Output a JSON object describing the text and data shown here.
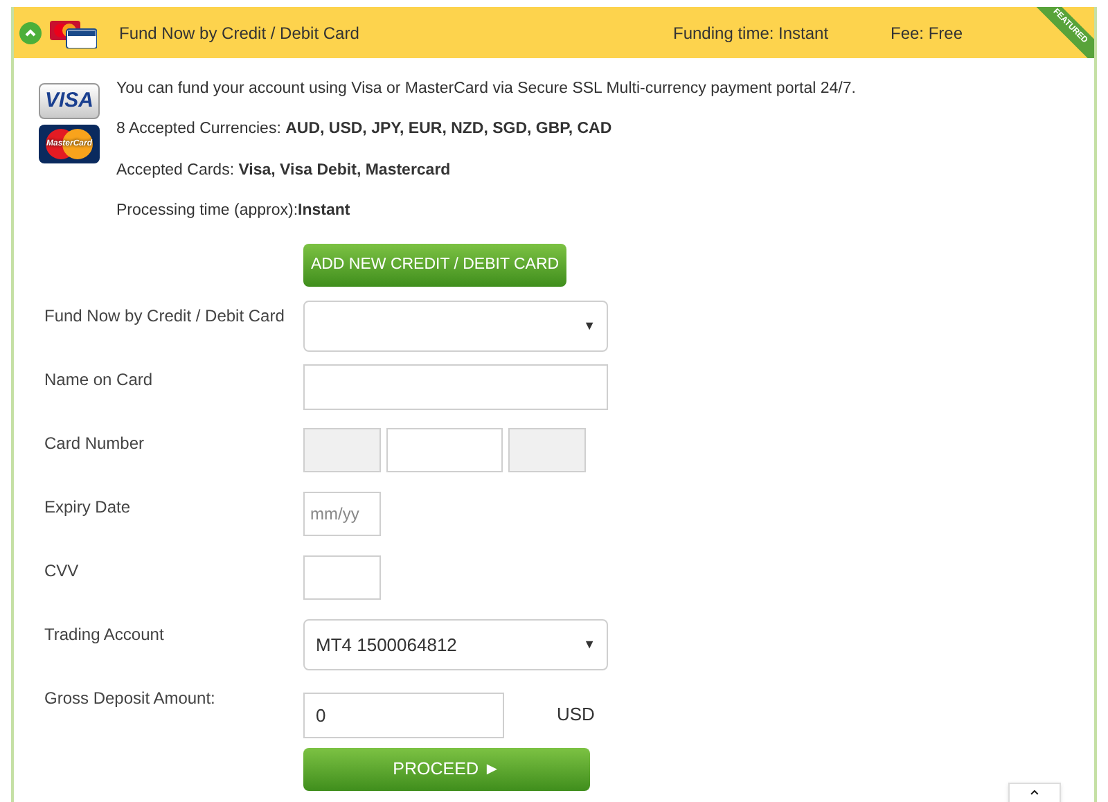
{
  "header": {
    "title": "Fund Now by Credit / Debit Card",
    "funding_time": "Funding time: Instant",
    "fee": "Fee: Free",
    "ribbon": "FEATURED",
    "expanded": true
  },
  "logos": {
    "visa": "VISA",
    "mastercard": "MasterCard"
  },
  "info": [
    "You can fund your account using Visa or MasterCard via Secure SSL Multi-currency payment portal 24/7.",
    "8 Accepted Currencies: **AUD, USD, JPY, EUR, NZD, SGD, GBP, CAD**",
    "Accepted Cards: **Visa, Visa Debit, Mastercard**",
    "Processing time (approx):**Instant**"
  ],
  "add_card_button": "ADD NEW CREDIT / DEBIT CARD",
  "fields": [
    {
      "kind": "select",
      "label": "Fund Now by Credit / Debit Card",
      "arrow": "▼"
    },
    {
      "kind": "text",
      "label": "Name on Card"
    },
    {
      "kind": "card",
      "label": "Card Number"
    },
    {
      "kind": "small",
      "label": "Expiry Date",
      "placeholder": "mm/yy"
    },
    {
      "kind": "small",
      "label": "CVV"
    },
    {
      "kind": "select",
      "label": "Trading Account",
      "value": "MT4 1500064812",
      "arrow": "▼"
    },
    {
      "kind": "amount",
      "label": "Gross Deposit Amount:",
      "value": "0",
      "unit": "USD"
    }
  ],
  "proceed_button": "PROCEED ►",
  "scroll_top_button": "⌃"
}
